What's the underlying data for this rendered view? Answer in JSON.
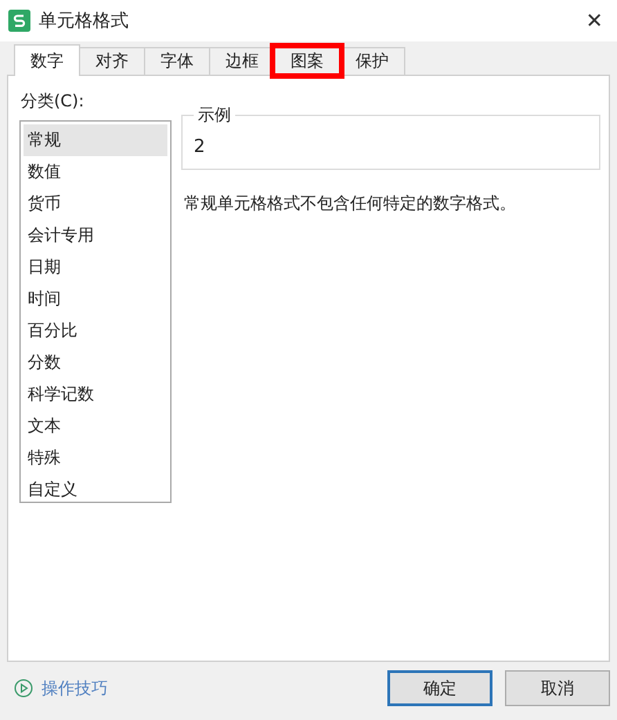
{
  "window": {
    "title": "单元格格式",
    "close": "✕"
  },
  "tabs": [
    {
      "label": "数字",
      "selected": true,
      "highlighted": false
    },
    {
      "label": "对齐",
      "selected": false,
      "highlighted": false
    },
    {
      "label": "字体",
      "selected": false,
      "highlighted": false
    },
    {
      "label": "边框",
      "selected": false,
      "highlighted": false
    },
    {
      "label": "图案",
      "selected": false,
      "highlighted": true
    },
    {
      "label": "保护",
      "selected": false,
      "highlighted": false
    }
  ],
  "category": {
    "label": "分类(C):",
    "items": [
      {
        "label": "常规",
        "selected": true
      },
      {
        "label": "数值",
        "selected": false
      },
      {
        "label": "货币",
        "selected": false
      },
      {
        "label": "会计专用",
        "selected": false
      },
      {
        "label": "日期",
        "selected": false
      },
      {
        "label": "时间",
        "selected": false
      },
      {
        "label": "百分比",
        "selected": false
      },
      {
        "label": "分数",
        "selected": false
      },
      {
        "label": "科学记数",
        "selected": false
      },
      {
        "label": "文本",
        "selected": false
      },
      {
        "label": "特殊",
        "selected": false
      },
      {
        "label": "自定义",
        "selected": false
      }
    ]
  },
  "sample": {
    "label": "示例",
    "value": "2"
  },
  "description": "常规单元格格式不包含任何特定的数字格式。",
  "help_link": "操作技巧",
  "buttons": [
    {
      "label": "确定",
      "default": true
    },
    {
      "label": "取消",
      "default": false
    }
  ]
}
